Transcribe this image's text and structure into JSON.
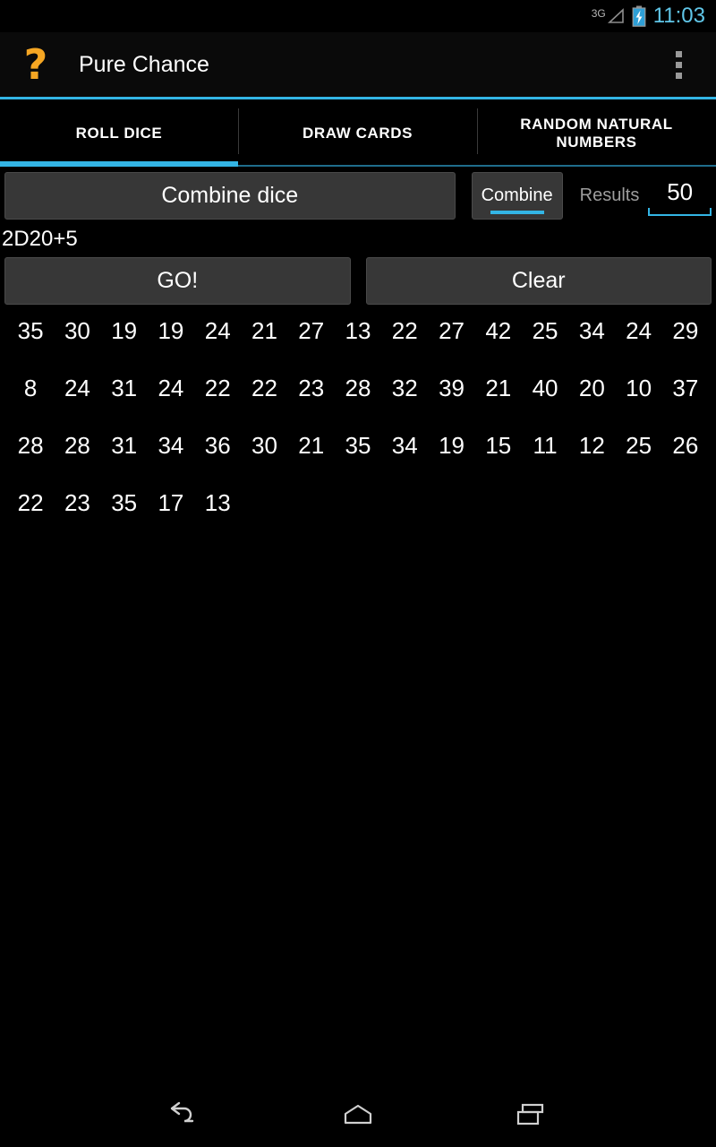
{
  "statusbar": {
    "network_label": "3G",
    "signal_icon": "signal-triangle-icon",
    "battery_icon": "battery-charging-icon",
    "clock": "11:03",
    "clock_color": "#60c6e8"
  },
  "actionbar": {
    "logo_icon": "question-mark-logo",
    "logo_glyph": "?",
    "logo_color": "#f5a623",
    "title": "Pure Chance",
    "overflow_icon": "overflow-menu-icon"
  },
  "tabs": {
    "accent_color": "#33b5e5",
    "items": [
      {
        "label": "ROLL DICE",
        "active": true
      },
      {
        "label": "DRAW CARDS",
        "active": false
      },
      {
        "label": "RANDOM NATURAL NUMBERS",
        "active": false
      }
    ]
  },
  "controls": {
    "combine_dice_label": "Combine dice",
    "combine_toggle_label": "Combine",
    "results_label": "Results",
    "results_count_value": "50",
    "formula": "2D20+5",
    "go_label": "GO!",
    "clear_label": "Clear"
  },
  "results": {
    "values": [
      "35",
      "30",
      "19",
      "19",
      "24",
      "21",
      "27",
      "13",
      "22",
      "27",
      "42",
      "25",
      "34",
      "24",
      "29",
      "8",
      "24",
      "31",
      "24",
      "22",
      "22",
      "23",
      "28",
      "32",
      "39",
      "21",
      "40",
      "20",
      "10",
      "37",
      "28",
      "28",
      "31",
      "34",
      "36",
      "30",
      "21",
      "35",
      "34",
      "19",
      "15",
      "11",
      "12",
      "25",
      "26",
      "22",
      "23",
      "35",
      "17",
      "13"
    ]
  },
  "navbar": {
    "back_icon": "back-arrow-icon",
    "home_icon": "home-icon",
    "recents_icon": "recents-icon"
  }
}
